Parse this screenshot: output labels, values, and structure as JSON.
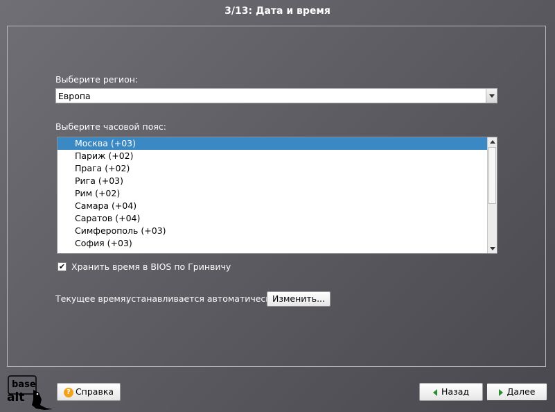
{
  "window": {
    "title": "3/13: Дата и время"
  },
  "region": {
    "label": "Выберите регион:",
    "selected": "Европа"
  },
  "timezone": {
    "label": "Выберите часовой пояс:",
    "items": [
      {
        "label": "Москва (+03)",
        "selected": true
      },
      {
        "label": "Париж (+02)"
      },
      {
        "label": "Прага (+02)"
      },
      {
        "label": "Рига (+03)"
      },
      {
        "label": "Рим (+02)"
      },
      {
        "label": "Самара (+04)"
      },
      {
        "label": "Саратов (+04)"
      },
      {
        "label": "Симферополь (+03)"
      },
      {
        "label": "София (+03)"
      }
    ]
  },
  "bios_utc": {
    "label": "Хранить время в BIOS по Гринвичу",
    "checked": true,
    "check_glyph": "✔"
  },
  "current_time": {
    "label": "Текущее время:",
    "value": "устанавливается автоматически",
    "change_button": "Изменить..."
  },
  "footer": {
    "help_button": "Справка",
    "help_icon_glyph": "?",
    "back_button": "Назад",
    "next_button": "Далее",
    "logo_text_top": "base",
    "logo_text_bottom": "alt"
  },
  "colors": {
    "selection": "#3a88c4",
    "help_icon": "#f2a31b",
    "nav_arrow": "#2e8b2e"
  }
}
